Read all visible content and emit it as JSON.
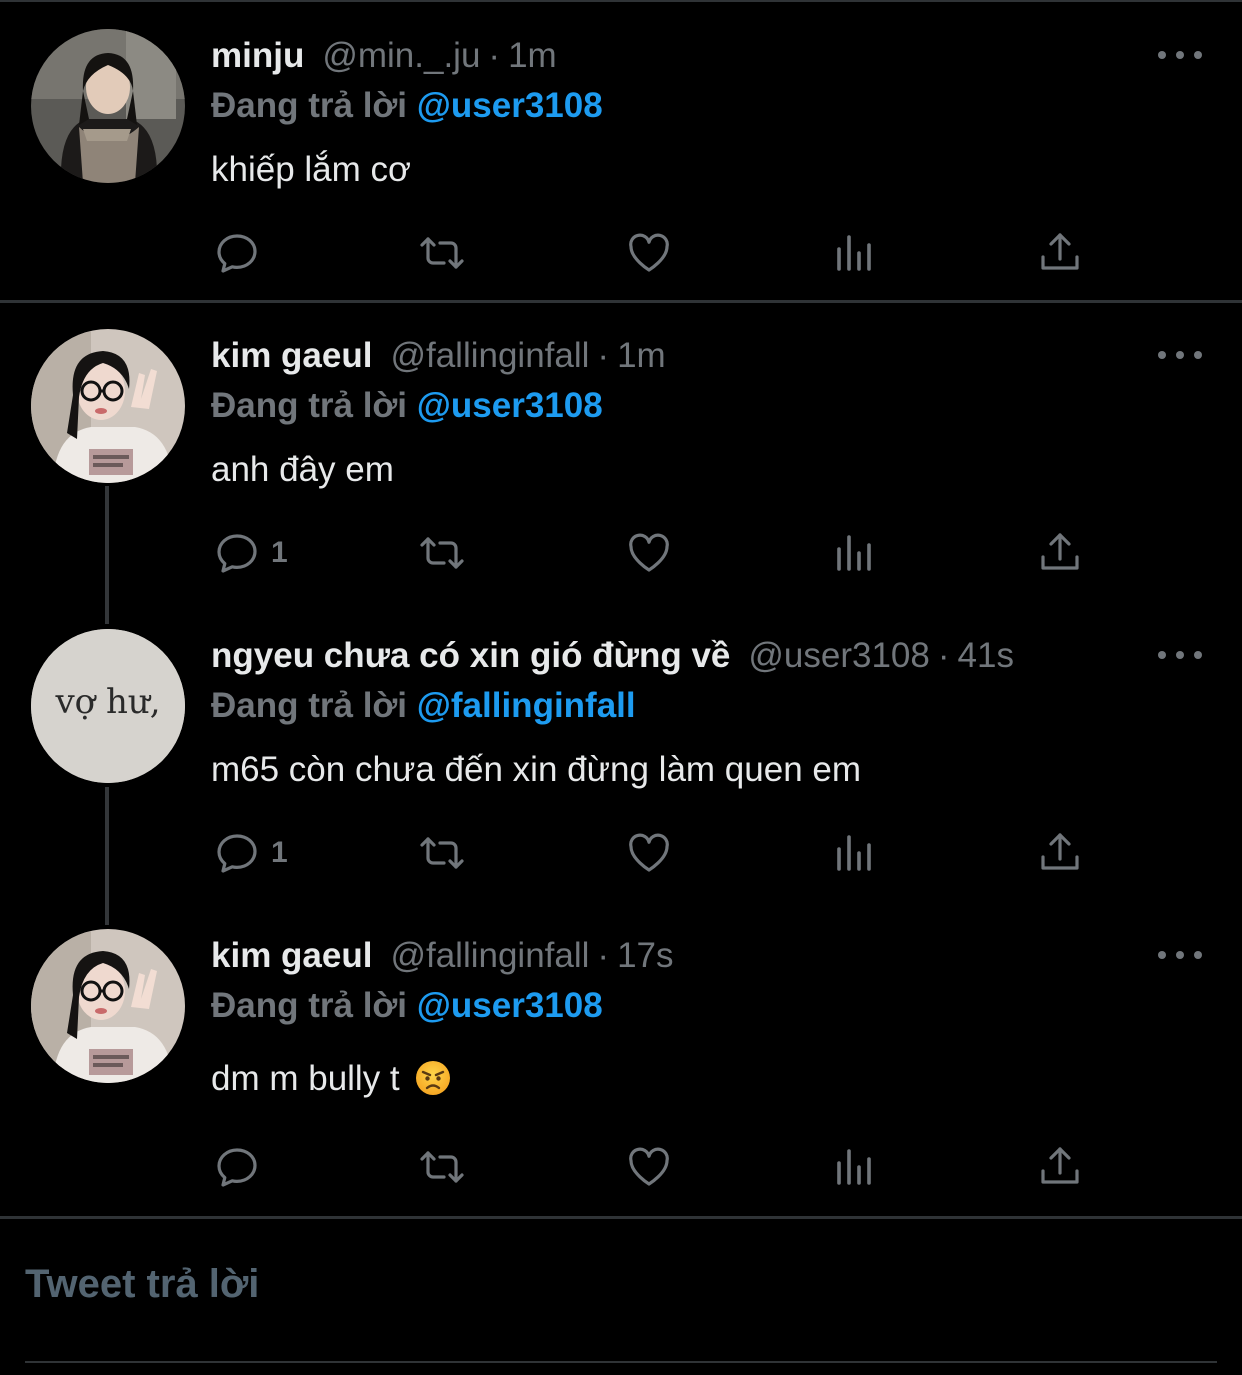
{
  "replying_label": "Đang trả lời",
  "tweets": [
    {
      "name": "minju",
      "handle": "@min._.ju",
      "time": "1m",
      "reply_to": "@user3108",
      "text": "khiếp lắm cơ",
      "reply_count": "",
      "avatar": "minju-avatar"
    },
    {
      "name": "kim gaeul",
      "handle": "@fallinginfall",
      "time": "1m",
      "reply_to": "@user3108",
      "text": "anh đây em",
      "reply_count": "1",
      "avatar": "kim-gaeul-avatar"
    },
    {
      "name": "ngyeu chưa có xin gió đừng về",
      "handle": "@user3108",
      "time": "41s",
      "reply_to": "@fallinginfall",
      "text": "m65 còn chưa đến xin đừng làm quen em",
      "reply_count": "1",
      "avatar": "vo-hu-avatar",
      "avatar_text": "vợ hư,"
    },
    {
      "name": "kim gaeul",
      "handle": "@fallinginfall",
      "time": "17s",
      "reply_to": "@user3108",
      "text": "dm m bully t",
      "emoji": "angry-face-emoji",
      "reply_count": "",
      "avatar": "kim-gaeul-avatar"
    }
  ],
  "compose": {
    "placeholder": "Tweet trả lời"
  },
  "colors": {
    "background": "#000000",
    "mention": "#1d9bf0",
    "muted": "#71767b",
    "divider": "#2f3336"
  }
}
